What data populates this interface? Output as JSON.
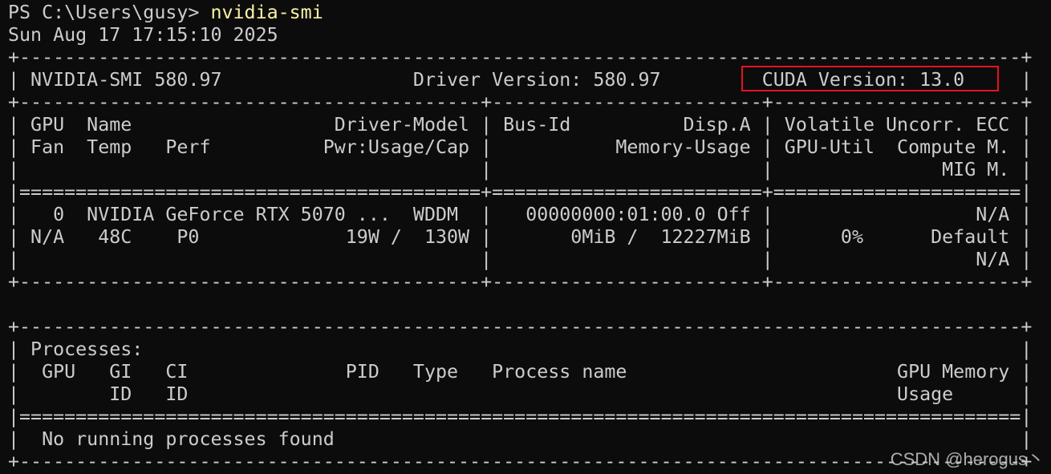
{
  "prompt": {
    "path": "PS C:\\Users\\gusy> ",
    "command": "nvidia-smi"
  },
  "timestamp": "Sun Aug 17 17:15:10 2025",
  "smi_header": {
    "border_top": "+-----------------------------------------------------------------------------------------+",
    "line": "| NVIDIA-SMI 580.97                 Driver Version: 580.97         CUDA Version: 13.0     |",
    "cuda_version_highlight": "CUDA Version: 13.0"
  },
  "gpu_table": {
    "sep_top": "+-----------------------------------------+------------------------+----------------------+",
    "header_1": "| GPU  Name                  Driver-Model | Bus-Id          Disp.A | Volatile Uncorr. ECC |",
    "header_2": "| Fan  Temp   Perf          Pwr:Usage/Cap |           Memory-Usage | GPU-Util  Compute M. |",
    "header_3": "|                                         |                        |               MIG M. |",
    "sep_double": "|=========================================+========================+======================|",
    "row_1": "|   0  NVIDIA GeForce RTX 5070 ...  WDDM  |   00000000:01:00.0 Off |                  N/A |",
    "row_2": "| N/A   48C    P0             19W /  130W |       0MiB /  12227MiB |      0%      Default |",
    "row_3": "|                                         |                        |                  N/A |",
    "sep_bottom": "+-----------------------------------------+------------------------+----------------------+"
  },
  "processes_table": {
    "border_top": "+-----------------------------------------------------------------------------------------+",
    "title": "| Processes:                                                                              |",
    "header_1": "|  GPU   GI   CI              PID   Type   Process name                        GPU Memory |",
    "header_2": "|        ID   ID                                                               Usage      |",
    "sep_double": "|=========================================================================================|",
    "row_1": "|  No running processes found                                                             |",
    "border_bottom": "+-----------------------------------------------------------------------------------------+"
  },
  "watermark": "CSDN @herogus丶",
  "colors": {
    "background": "#0c0c0c",
    "text": "#cccccc",
    "command": "#f9f1a5",
    "highlight_box": "#e81123"
  }
}
